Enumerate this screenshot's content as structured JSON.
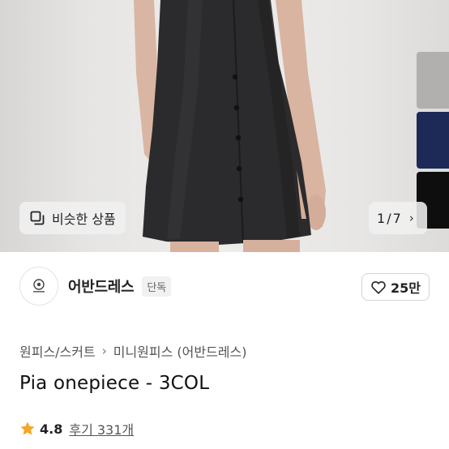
{
  "hero": {
    "similar_label": "비슷한 상품",
    "counter_current": "1",
    "counter_sep": "/",
    "counter_total": "7",
    "swatch_colors": [
      "#b1b0af",
      "#1d2a57",
      "#0e0e0e"
    ]
  },
  "brand": {
    "name": "어반드레스",
    "badge": "단독",
    "likes": "25만"
  },
  "breadcrumb": {
    "level1": "원피스/스커트",
    "level2": "미니원피스 (어반드레스)"
  },
  "product": {
    "title": "Pia onepiece - 3COL"
  },
  "rating": {
    "score": "4.8",
    "reviews": "후기 331개",
    "star_color": "#f5a623"
  }
}
